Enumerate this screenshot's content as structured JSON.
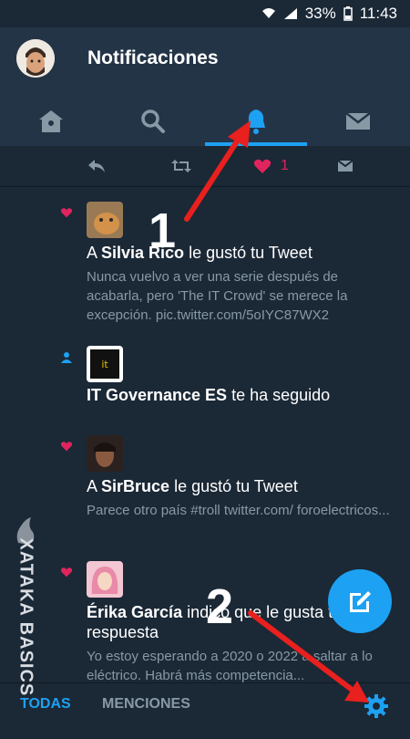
{
  "status": {
    "battery": "33%",
    "time": "11:43"
  },
  "header": {
    "title": "Notificaciones"
  },
  "tabs": [
    {
      "name": "home",
      "icon": "home-icon"
    },
    {
      "name": "search",
      "icon": "search-icon"
    },
    {
      "name": "notifications",
      "icon": "bell-icon",
      "active": true
    },
    {
      "name": "messages",
      "icon": "mail-icon"
    }
  ],
  "filters": [
    {
      "icon": "reply-icon"
    },
    {
      "icon": "retweet-icon"
    },
    {
      "icon": "heart-icon",
      "count": "1"
    },
    {
      "icon": "mail-icon"
    }
  ],
  "notifications": [
    {
      "type": "like",
      "prefix": "A ",
      "user": "Silvia Rico",
      "action": " le gustó tu Tweet",
      "text": "Nunca vuelvo a ver una serie después de acabarla, pero 'The IT Crowd' se merece la excepción. pic.twitter.com/5oIYC87WX2"
    },
    {
      "type": "follow",
      "prefix": "",
      "user": "IT Governance ES",
      "action": " te ha seguido",
      "text": ""
    },
    {
      "type": "like",
      "prefix": "A ",
      "user": "SirBruce",
      "action": " le gustó tu Tweet",
      "text": "Parece otro país #troll twitter.com/ foroelectricos..."
    },
    {
      "type": "like",
      "prefix": "",
      "user": "Érika García",
      "action": " indicó que le gusta tu",
      "line2": "respuesta",
      "text": "Yo estoy esperando a 2020 o 2022 a saltar a lo eléctrico. Habrá más competencia..."
    }
  ],
  "bottom": {
    "tab_all": "TODAS",
    "tab_mentions": "MENCIONES"
  },
  "annotations": {
    "num1": "1",
    "num2": "2",
    "watermark": "XATAKA BASICS"
  },
  "colors": {
    "accent": "#1da1f2",
    "like": "#e0245e",
    "bg": "#1b2836",
    "arrow": "#e8201e"
  }
}
